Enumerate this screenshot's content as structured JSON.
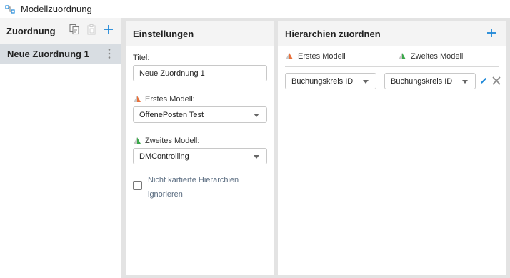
{
  "window": {
    "title": "Modellzuordnung",
    "icon": "mapping-icon"
  },
  "left_panel": {
    "title": "Zuordnung",
    "tools": [
      "copy-icon",
      "paste-icon",
      "plus-icon"
    ],
    "items": [
      {
        "label": "Neue Zuordnung 1",
        "selected": true
      }
    ]
  },
  "settings": {
    "title": "Einstellungen",
    "title_label": "Titel:",
    "title_value": "Neue Zuordnung 1",
    "first_model_label": "Erstes Modell:",
    "first_model_value": "OffenePosten Test",
    "second_model_label": "Zweites Modell:",
    "second_model_value": "DMControlling",
    "ignore_label": "Nicht kartierte Hierarchien ignorieren",
    "ignore_checked": false
  },
  "hierarchies": {
    "title": "Hierarchien zuordnen",
    "col_first": "Erstes Modell",
    "col_second": "Zweites Modell",
    "rows": [
      {
        "first": "Buchungskreis ID",
        "second": "Buchungskreis ID"
      }
    ]
  },
  "colors": {
    "accent": "#1e88d8",
    "first_model_orange": "#e8703a",
    "second_model_green": "#3aa84a",
    "selected_row": "#d8dde2",
    "workspace_bg": "#e3e3e3"
  }
}
